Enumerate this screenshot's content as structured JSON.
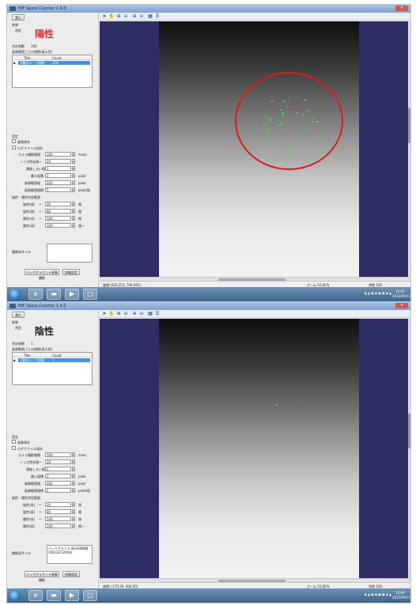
{
  "app": {
    "title": "MIF Spore Counter 1.4.0",
    "run_label": "実行"
  },
  "colors": {
    "positive_red": "#e03030",
    "negative_black": "#222222",
    "selection_blue": "#3399ff",
    "highlight_circle": "#e01a1a",
    "spore_green": "#3fdc3f"
  },
  "labels": {
    "result": "結果",
    "judge": "判定",
    "total_count": "合計個数",
    "per_range": "画像範囲ごとの個数(表示用)",
    "col_title": "Title",
    "col_count": "Count",
    "settings": "設定",
    "save_image": "画像保存",
    "save_log": "ログファイル保存",
    "camera_interval": "カメラ撮影間隔",
    "noise_removal": "ノイズ除去値",
    "brightness_threshold": "濃度しきい値",
    "min_area": "最小面積",
    "image_range_width": "画像範囲幅",
    "image_range_gap": "画像範囲間隔",
    "judge_thresholds": "陰性・陽性判定範囲",
    "neg_lower": "陰性(低)",
    "neg_upper": "陰性(高)",
    "pos_lower": "陽性(低)",
    "pos_upper": "陽性(高)",
    "memo": "撮像条件メモ",
    "bg_image_btn": "バックグラウンド画像撮影",
    "detail_btn": "詳細設定",
    "unit_msec": "msec",
    "unit_pixel": "pixel",
    "unit_pixel_interval": "pixel/個",
    "unit_count": "個",
    "unit_count_more": "個～",
    "tilde": "～"
  },
  "top": {
    "judge_value": "陽性",
    "total_value": "300",
    "row_title": "6番目ループ画像",
    "row_count": "256",
    "values": {
      "camera_interval": "100",
      "noise_removal": "20",
      "brightness_threshold": "2",
      "min_area": "2",
      "image_range_width": "200",
      "image_range_gap": "5",
      "neg_lower": "20",
      "neg_upper": "80",
      "pos_lower": "100",
      "pos_upper": "100"
    },
    "memo_text": "",
    "status_coords": "座標 (263,253, 794,655)",
    "zoom": "ズーム 55.82%",
    "state": "状態 100",
    "clock_time": "15:02",
    "clock_date": "2013/09/11"
  },
  "bottom": {
    "judge_value": "陰性",
    "total_value": "1",
    "row_title": "6番目ループ画像",
    "row_count": "1",
    "values": {
      "camera_interval": "100",
      "noise_removal": "20",
      "brightness_threshold": "2",
      "min_area": "2",
      "image_range_width": "200",
      "image_range_gap": "5",
      "neg_lower": "20",
      "neg_upper": "80",
      "pos_lower": "100",
      "pos_upper": "100"
    },
    "memo_text": "バックグランド:原水60時間 100(3)21200倍",
    "status_coords": "座標 (-170.36, 404.05)",
    "zoom": "ズーム 55.82%",
    "state": "状態 100",
    "clock_time": "15:06",
    "clock_date": "2013/09/11"
  },
  "icons": {
    "cursor": "cursor-icon",
    "hand": "hand-icon",
    "zoom_in": "zoom-in-icon",
    "zoom_out": "zoom-out-icon",
    "fit": "fit-icon",
    "grid": "grid-icon",
    "list": "list-icon"
  }
}
